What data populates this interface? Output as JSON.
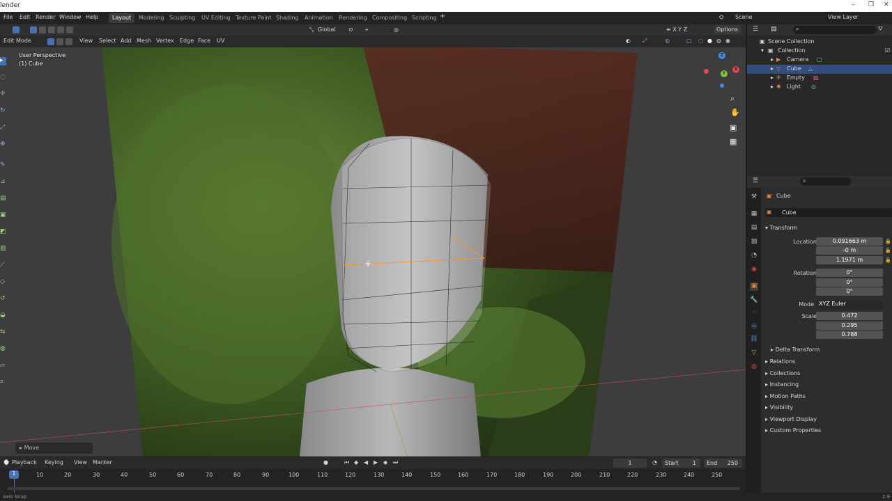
{
  "titlebar": {
    "title": "lender",
    "min": "–",
    "restore": "❐",
    "close": "✕"
  },
  "menu": {
    "file": "File",
    "edit": "Edit",
    "render": "Render",
    "window": "Window",
    "help": "Help"
  },
  "workspaces": [
    "Layout",
    "Modeling",
    "Sculpting",
    "UV Editing",
    "Texture Paint",
    "Shading",
    "Animation",
    "Rendering",
    "Compositing",
    "Scripting"
  ],
  "scene": {
    "name": "Scene",
    "view_layer": "View Layer"
  },
  "toolbar": {
    "orientation": "Global",
    "options": "Options"
  },
  "viewport_header": {
    "mode": "Edit Mode",
    "view": "View",
    "select": "Select",
    "add": "Add",
    "mesh": "Mesh",
    "vertex": "Vertex",
    "edge": "Edge",
    "face": "Face",
    "uv": "UV"
  },
  "viewport": {
    "perspective": "User Perspective",
    "object": "(1) Cube",
    "last_op": "Move"
  },
  "gizmo": {
    "x": "X",
    "y": "Y",
    "z": "Z"
  },
  "outliner": {
    "items": [
      {
        "label": "Scene Collection",
        "indent": 0
      },
      {
        "label": "Collection",
        "indent": 1
      },
      {
        "label": "Camera",
        "indent": 2
      },
      {
        "label": "Cube",
        "indent": 2,
        "selected": true
      },
      {
        "label": "Empty",
        "indent": 2
      },
      {
        "label": "Light",
        "indent": 2
      }
    ]
  },
  "properties": {
    "object_name": "Cube",
    "datablock": "Cube",
    "transform_header": "Transform",
    "location": {
      "label": "Location X",
      "x": "0.091663 m",
      "y": "-0 m",
      "z": "1.1971 m"
    },
    "rotation": {
      "label": "Rotation X",
      "x": "0°",
      "y": "0°",
      "z": "0°"
    },
    "mode": {
      "label": "Mode",
      "value": "XYZ Euler"
    },
    "scale": {
      "label": "Scale X",
      "x": "0.472",
      "y": "0.295",
      "z": "0.788"
    },
    "y_label": "Y",
    "z_label": "Z",
    "delta_transform": "Delta Transform",
    "sections": [
      "Relations",
      "Collections",
      "Instancing",
      "Motion Paths",
      "Visibility",
      "Viewport Display",
      "Custom Properties"
    ]
  },
  "timeline": {
    "playback": "Playback",
    "keying": "Keying",
    "view": "View",
    "marker": "Marker",
    "current_frame": "1",
    "start_label": "Start",
    "start": "1",
    "end_label": "End",
    "end": "250",
    "ticks": [
      "1",
      "10",
      "20",
      "30",
      "40",
      "50",
      "60",
      "70",
      "80",
      "90",
      "100",
      "110",
      "120",
      "130",
      "140",
      "150",
      "160",
      "170",
      "180",
      "190",
      "200",
      "210",
      "220",
      "230",
      "240",
      "250"
    ]
  },
  "statusbar": {
    "left": "Axis Snap",
    "version": "2.9"
  },
  "colors": {
    "accent": "#4772b3",
    "selected_row": "#334d80",
    "x_axis": "#e04a54",
    "y_axis": "#84c33a",
    "z_axis": "#3a8ee6"
  }
}
